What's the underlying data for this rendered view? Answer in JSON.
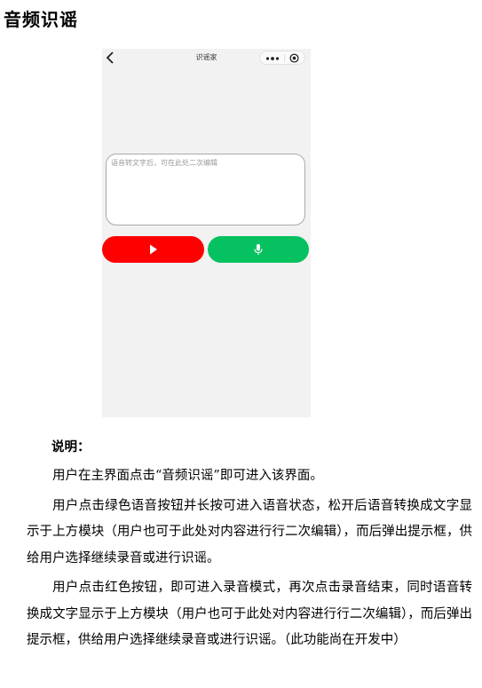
{
  "doc": {
    "title": "音频识谣"
  },
  "phone": {
    "nav_title": "识谣家",
    "input_placeholder": "语音转文字后，可在此处二次编辑",
    "record_button_color": "#fe0000",
    "voice_button_color": "#06c160",
    "icons": {
      "back": "chevron-left-icon",
      "more": "more-dots-icon",
      "target": "target-icon",
      "play": "play-icon",
      "mic": "microphone-icon"
    }
  },
  "notes": {
    "title": "说明：",
    "paragraphs": [
      "用户在主界面点击“音频识谣”即可进入该界面。",
      "用户点击绿色语音按钮并长按可进入语音状态，松开后语音转换成文字显示于上方模块（用户也可于此处对内容进行行二次编辑），而后弹出提示框，供给用户选择继续录音或进行识谣。",
      "用户点击红色按钮，即可进入录音模式，再次点击录音结束，同时语音转换成文字显示于上方模块（用户也可于此处对内容进行行二次编辑），而后弹出提示框，供给用户选择继续录音或进行识谣。（此功能尚在开发中）"
    ]
  }
}
